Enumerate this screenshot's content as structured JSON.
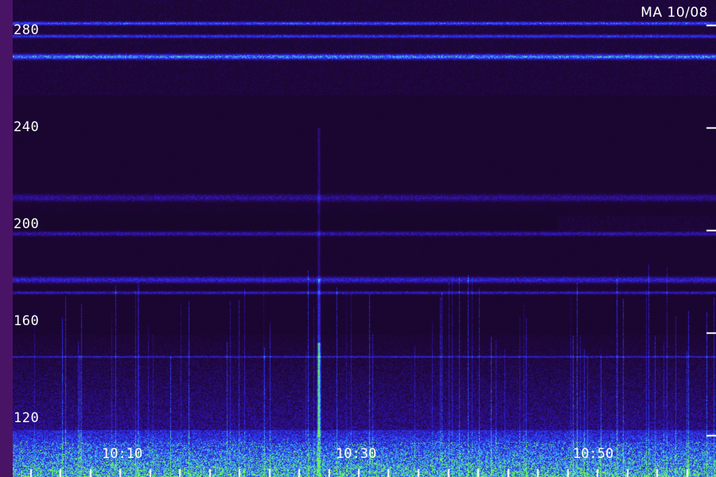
{
  "chart_data": {
    "type": "heatmap",
    "title": "MA 10/08",
    "xlabel": "",
    "ylabel": "",
    "y_ticks": [
      {
        "value": 120,
        "label": "120"
      },
      {
        "value": 160,
        "label": "160"
      },
      {
        "value": 200,
        "label": "200"
      },
      {
        "value": 240,
        "label": "240"
      },
      {
        "value": 280,
        "label": "280"
      }
    ],
    "ylim": [
      104,
      290
    ],
    "x_ticks": [
      {
        "value": 10,
        "label": "10:10"
      },
      {
        "value": 30,
        "label": "10:30"
      },
      {
        "value": 50,
        "label": "10:50"
      }
    ],
    "xlim": [
      9,
      69
    ],
    "colors": {
      "background": "#1a0730",
      "low": "#2a0a4a",
      "mid": "#3a2ad0",
      "high": "#4a8cff",
      "peak": "#6aff40",
      "axis_bar": "#4a1466",
      "text": "#ffffff"
    }
  }
}
